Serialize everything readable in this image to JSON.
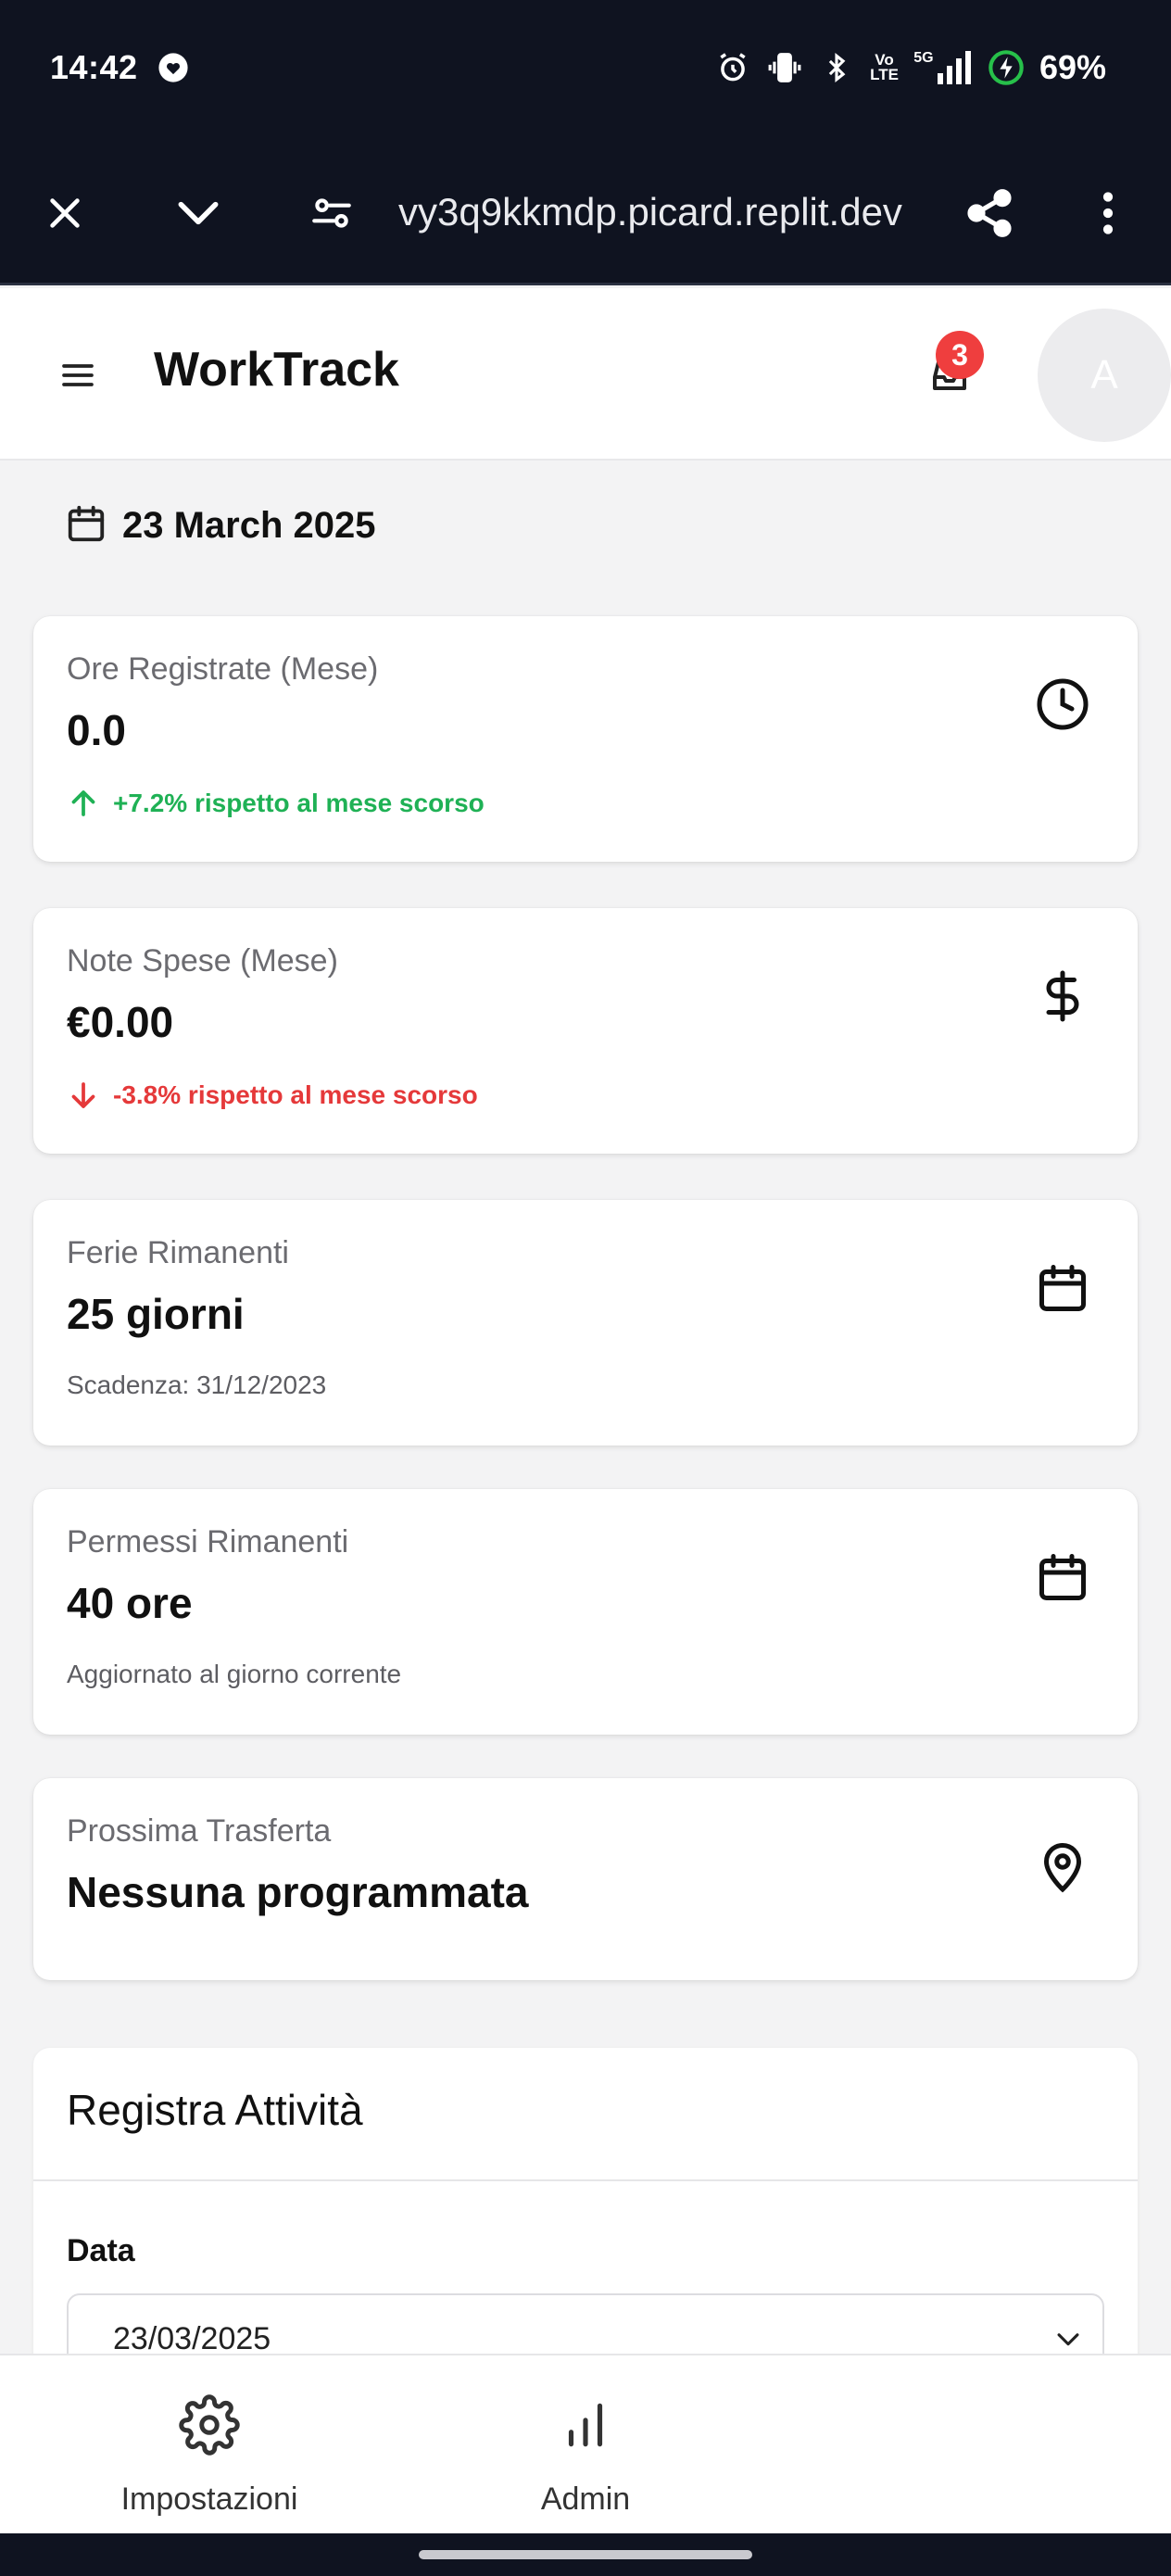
{
  "status_bar": {
    "time": "14:42",
    "network_badge": "Vo\nLTE",
    "network_type": "5G",
    "battery": "69%"
  },
  "browser": {
    "url": "vy3q9kkmdp.picard.replit.dev"
  },
  "header": {
    "title": "WorkTrack",
    "notification_count": "3",
    "avatar_initial": "A"
  },
  "date_display": "23 March 2025",
  "cards": [
    {
      "label": "Ore Registrate (Mese)",
      "value": "0.0",
      "note": "+7.2% rispetto al mese scorso",
      "trend": "up",
      "icon": "clock-icon"
    },
    {
      "label": "Note Spese (Mese)",
      "value": "€0.00",
      "note": "-3.8% rispetto al mese scorso",
      "trend": "down",
      "icon": "dollar-icon"
    },
    {
      "label": "Ferie Rimanenti",
      "value": "25 giorni",
      "note": "Scadenza: 31/12/2023",
      "trend": "none",
      "icon": "calendar-icon"
    },
    {
      "label": "Permessi Rimanenti",
      "value": "40 ore",
      "note": "Aggiornato al giorno corrente",
      "trend": "none",
      "icon": "calendar-icon"
    },
    {
      "label": "Prossima Trasferta",
      "value": "Nessuna programmata",
      "note": "",
      "trend": "none",
      "icon": "map-pin-icon"
    }
  ],
  "activity": {
    "title": "Registra Attività",
    "date_label": "Data",
    "date_value": "23/03/2025"
  },
  "bottom_nav": [
    {
      "label": "Impostazioni",
      "icon": "gear-icon"
    },
    {
      "label": "Admin",
      "icon": "bar-chart-icon"
    }
  ],
  "colors": {
    "up": "#1fb155",
    "down": "#e5393a",
    "badge": "#ef3e3e",
    "system_bar": "#0f1320"
  }
}
